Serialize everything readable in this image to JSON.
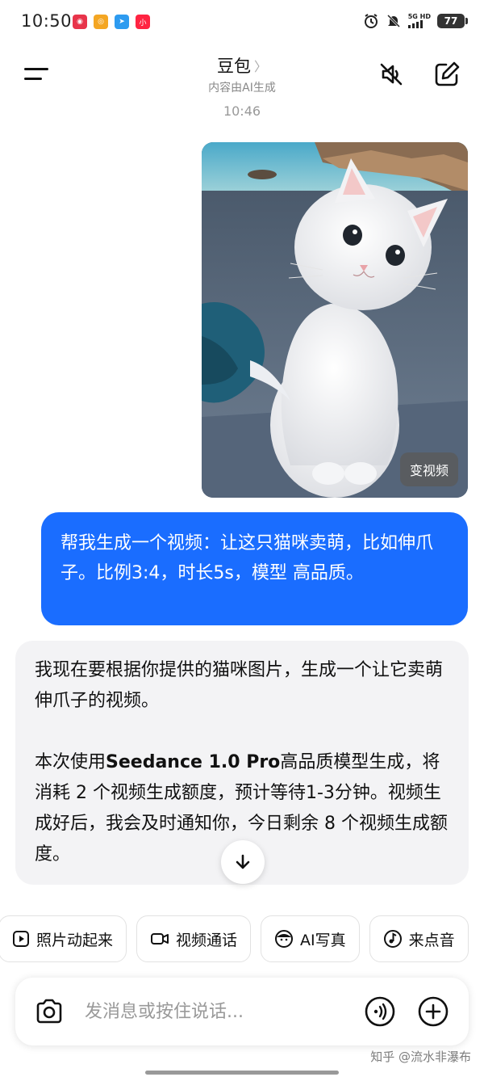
{
  "status_bar": {
    "time": "10:50",
    "network": "5G HD",
    "battery": "77",
    "app_icons": [
      {
        "icon": "fox-app-icon",
        "color": "#e8344a",
        "label": "◉"
      },
      {
        "icon": "weibo-icon",
        "color": "#f4a623",
        "label": "◎"
      },
      {
        "icon": "send-app-icon",
        "color": "#2d9bf0",
        "label": "➤"
      },
      {
        "icon": "xiaohongshu-icon",
        "color": "#ff2442",
        "label": "小"
      }
    ]
  },
  "header": {
    "title": "豆包",
    "subtitle": "内容由AI生成",
    "mute_icon": "speaker-muted-icon",
    "edit_icon": "new-chat-icon"
  },
  "conversation": {
    "time_divider": "10:46",
    "image_action": "变视频",
    "user_message": "帮我生成一个视频：让这只猫咪卖萌，比如伸爪子。比例3:4，时长5s，模型 高品质。",
    "ai_reply": {
      "para1": "我现在要根据你提供的猫咪图片，生成一个让它卖萌伸爪子的视频。",
      "para2_prefix": "本次使用",
      "para2_model": "Seedance 1.0 Pro",
      "para2_rest": "高品质模型生成，将消耗 2 个视频生成额度，预计等待1-3分钟。视频生成好后，我会及时通知你，今日剩余 8 个视频生成额度。"
    }
  },
  "quick_actions": [
    {
      "label": "照片动起来",
      "icon": "play-square-icon"
    },
    {
      "label": "视频通话",
      "icon": "video-camera-icon"
    },
    {
      "label": "AI写真",
      "icon": "face-icon"
    },
    {
      "label": "来点音",
      "icon": "music-note-icon"
    }
  ],
  "input": {
    "placeholder": "发消息或按住说话..."
  },
  "watermark": "知乎 @流水非瀑布",
  "colors": {
    "user_bubble": "#1a6dff",
    "ai_bubble": "#f3f3f5"
  }
}
